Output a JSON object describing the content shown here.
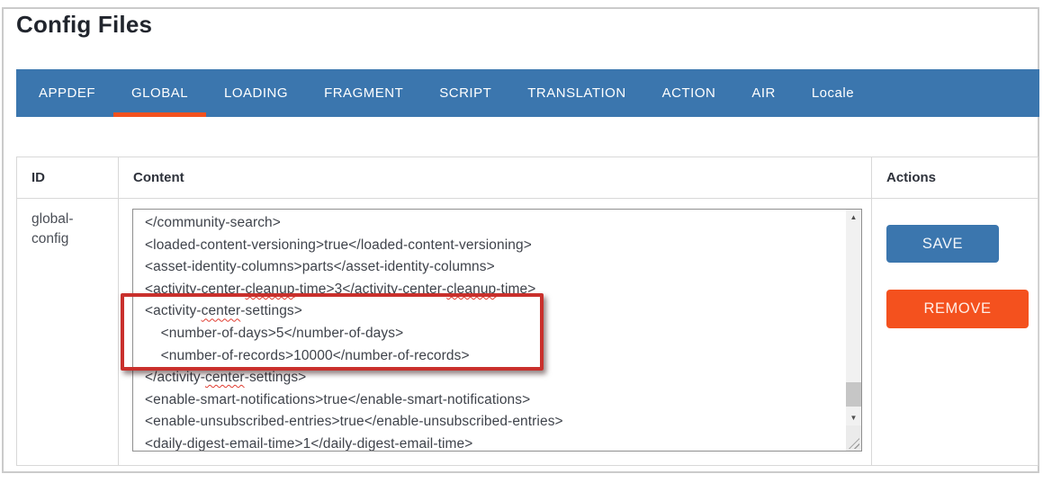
{
  "page": {
    "title": "Config Files"
  },
  "tabs": [
    {
      "label": "APPDEF",
      "active": false
    },
    {
      "label": "GLOBAL",
      "active": true
    },
    {
      "label": "LOADING",
      "active": false
    },
    {
      "label": "FRAGMENT",
      "active": false
    },
    {
      "label": "SCRIPT",
      "active": false
    },
    {
      "label": "TRANSLATION",
      "active": false
    },
    {
      "label": "ACTION",
      "active": false
    },
    {
      "label": "AIR",
      "active": false
    },
    {
      "label": "Locale",
      "active": false
    }
  ],
  "table": {
    "headers": {
      "id": "ID",
      "content": "Content",
      "actions": "Actions"
    }
  },
  "row": {
    "id": "global-config",
    "content_lines": [
      "</community-search>",
      "<loaded-content-versioning>true</loaded-content-versioning>",
      "<asset-identity-columns>parts</asset-identity-columns>",
      "<activity-center-cleanup-time>3</activity-center-cleanup-time>",
      "<activity-center-settings>",
      "    <number-of-days>5</number-of-days>",
      "    <number-of-records>10000</number-of-records>",
      "</activity-center-settings>",
      "<enable-smart-notifications>true</enable-smart-notifications>",
      "<enable-unsubscribed-entries>true</enable-unsubscribed-entries>",
      "<daily-digest-email-time>1</daily-digest-email-time>"
    ],
    "squiggles": {
      "3": "cleanup",
      "4": "center",
      "7": "center"
    }
  },
  "actions": {
    "save": "SAVE",
    "remove": "REMOVE"
  },
  "scrollbar": {
    "up_icon": "▲",
    "down_icon": "▼"
  },
  "colors": {
    "tab_bar": "#3b76ae",
    "active_tab_underline": "#f4511e",
    "save_button": "#3b76ae",
    "remove_button": "#f4511e",
    "highlight_box": "#c9302c"
  }
}
